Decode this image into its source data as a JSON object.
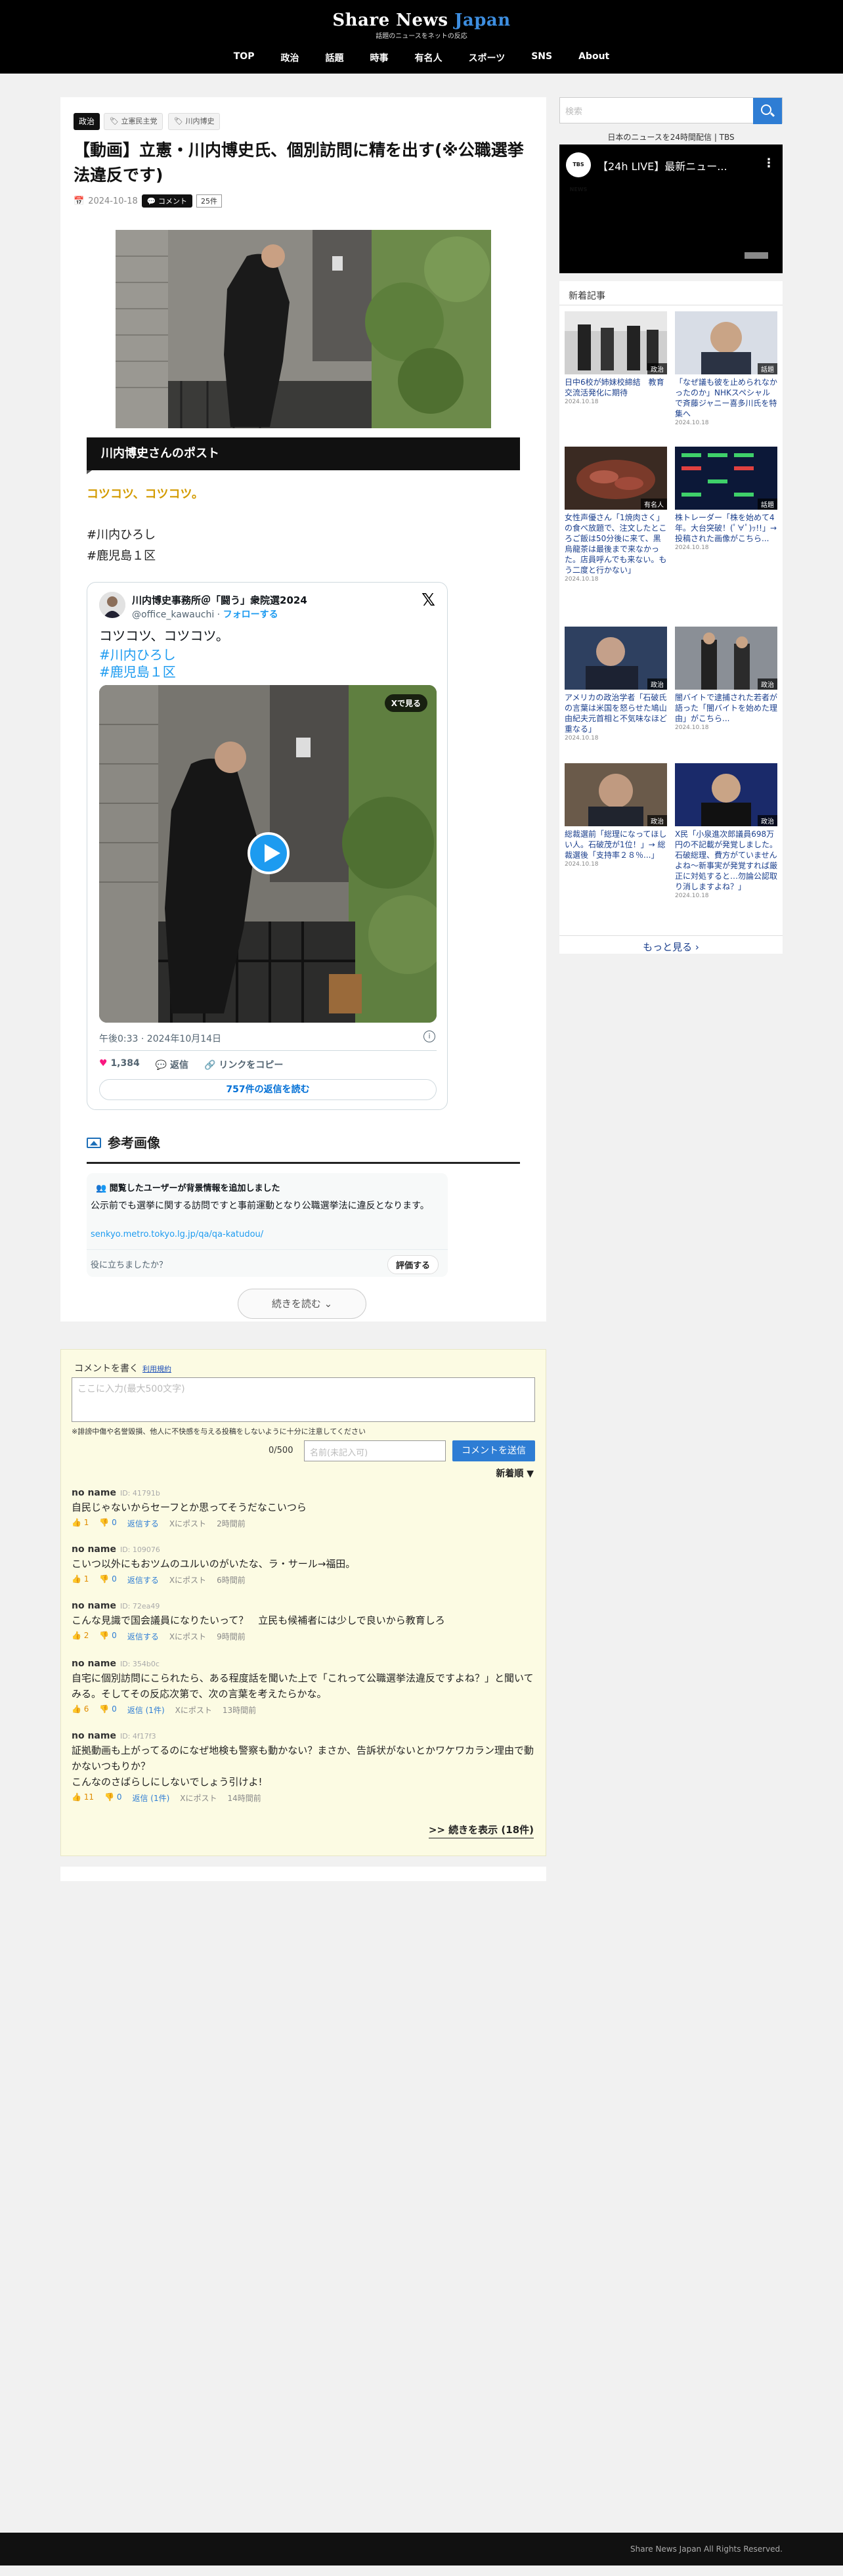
{
  "site": {
    "logo_a": "Share News",
    "logo_b": "Japan",
    "tagline": "話題のニュースをネットの反応"
  },
  "nav": [
    "TOP",
    "政治",
    "話題",
    "時事",
    "有名人",
    "スポーツ",
    "SNS",
    "About"
  ],
  "article": {
    "category": "政治",
    "tags": [
      "立憲民主党",
      "川内博史"
    ],
    "title": "【動画】立憲・川内博史氏、個別訪問に精を出す(※公職選挙法違反です)",
    "date": "2024-10-18",
    "comment_label": "コメント",
    "comment_count": "25件",
    "post_heading": "川内博史さんのポスト",
    "quote": "コツコツ、コツコツ。",
    "hashtags": [
      "#川内ひろし",
      "#鹿児島１区"
    ]
  },
  "tweet": {
    "name": "川内博史事務所＠「闘う」衆院選2024",
    "handle": "@office_kawauchi",
    "follow": "フォローする",
    "text": "コツコツ、コツコツ。",
    "tags": [
      "#川内ひろし",
      "#鹿児島１区"
    ],
    "see_on_x": "Xで見る",
    "time": "午後0:33 · 2024年10月14日",
    "likes": "1,384",
    "reply": "返信",
    "copy_link": "リンクをコピー",
    "read_replies": "757件の返信を読む"
  },
  "reference": {
    "heading": "参考画像",
    "note_title_a": "閲覧したユーザー",
    "note_title_b": "が背景情報を追加しました",
    "note_body": "公示前でも選挙に関する訪問ですと事前運動となり公職選挙法に違反となります。",
    "note_link": "senkyo.metro.tokyo.lg.jp/qa/qa-katudou/",
    "helpful": "役に立ちましたか？",
    "rate": "評価する"
  },
  "read_more": "続きを読む ⌄",
  "comments_form": {
    "label": "コメントを書く",
    "terms": "利用規約",
    "placeholder": "ここに入力(最大500文字)",
    "warning": "※誹謗中傷や名誉毀損、他人に不快感を与える投稿をしないように十分に注意してください",
    "count": "0/500",
    "name_placeholder": "名前(未記入可)",
    "submit": "コメントを送信",
    "sort": "新着順 ▼"
  },
  "comments": [
    {
      "name": "no name",
      "id": "ID: 41791b",
      "text": "自民じゃないからセーフとか思ってそうだなこいつら",
      "up": "1",
      "down": "0",
      "reply": "返信する",
      "x": "Xにポスト",
      "time": "2時間前"
    },
    {
      "name": "no name",
      "id": "ID: 109076",
      "text": "こいつ以外にもおツムのユルいのがいたな、ラ・サール→福田。",
      "up": "1",
      "down": "0",
      "reply": "返信する",
      "x": "Xにポスト",
      "time": "6時間前"
    },
    {
      "name": "no name",
      "id": "ID: 72ea49",
      "text": "こんな見識で国会議員になりたいって？　立民も候補者には少しで良いから教育しろ",
      "up": "2",
      "down": "0",
      "reply": "返信する",
      "x": "Xにポスト",
      "time": "9時間前"
    },
    {
      "name": "no name",
      "id": "ID: 354b0c",
      "text": "自宅に個別訪問にこられたら、ある程度話を聞いた上で「これって公職選挙法違反ですよね？」と聞いてみる。そしてその反応次第で、次の言葉を考えたらかな。",
      "up": "6",
      "down": "0",
      "reply": "返信 (1件)",
      "x": "Xにポスト",
      "time": "13時間前"
    },
    {
      "name": "no name",
      "id": "ID: 4f17f3",
      "text": "証拠動画も上がってるのになぜ地検も警察も動かない？まさか、告訴状がないとかワケワカラン理由で動かないつもりか？\nこんなのさばらしにしないでしょう引けよ!",
      "up": "11",
      "down": "0",
      "reply": "返信 (1件)",
      "x": "Xにポスト",
      "time": "14時間前"
    }
  ],
  "more_comments": ">> 続きを表示 (18件)",
  "sidebar": {
    "search_placeholder": "検索",
    "yt_caption": "日本のニュースを24時間配信 | TBS",
    "yt_logo": "TBS NEWS",
    "yt_title": "【24h LIVE】最新ニュー...",
    "new_heading": "新着記事",
    "more": "もっと見る ›",
    "articles": [
      {
        "label": "政治",
        "title": "日中6校が姉妹校締結　教育交流活発化に期待",
        "date": "2024.10.18"
      },
      {
        "label": "話題",
        "title": "「なぜ議も彼を止められなかったのか」NHKスペシャルで斉藤ジャニー喜多川氏を特集へ",
        "date": "2024.10.18"
      },
      {
        "label": "有名人",
        "title": "女性声優さん「1焼肉さく」の食べ放題で、注文したところご飯は50分後に来て、黒烏龍茶は最後まで来なかった。店員呼んでも来ない。もう二度と行かない」",
        "date": "2024.10.18"
      },
      {
        "label": "話題",
        "title": "株トレーダー「株を始めて4年。大台突破！(ﾟ∀ﾟ)ｯ!!」→ 投稿された画像がこちら...",
        "date": "2024.10.18"
      },
      {
        "label": "政治",
        "title": "アメリカの政治学者「石破氏の言葉は米国を怒らせた鳩山由紀夫元首相と不気味なほど重なる」",
        "date": "2024.10.18"
      },
      {
        "label": "政治",
        "title": "闇バイトで逮捕された若者が語った「闇バイトを始めた理由」がこちら...",
        "date": "2024.10.18"
      },
      {
        "label": "政治",
        "title": "総裁選前「総理になってほしい人。石破茂が1位！」→ 総裁選後「支持率２８％...」",
        "date": "2024.10.18"
      },
      {
        "label": "政治",
        "title": "X民「小泉進次郎議員698万円の不記載が発覚しました。石破総理、費方がていませんよね～新事実が発覚すれば厳正に対処すると…勿論公認取り消しますよね？」",
        "date": "2024.10.18"
      }
    ]
  },
  "footer": "Share News Japan All Rights Reserved."
}
